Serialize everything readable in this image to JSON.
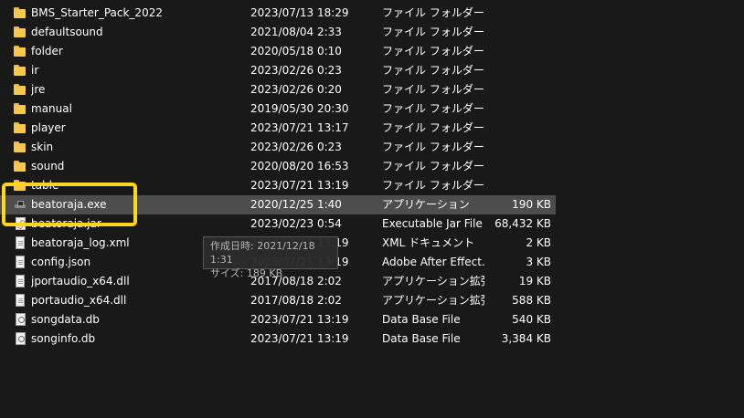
{
  "rows": [
    {
      "name": "BMS_Starter_Pack_2022",
      "date": "2023/07/13 18:29",
      "type": "ファイル フォルダー",
      "size": "",
      "icon": "folder-icon"
    },
    {
      "name": "defaultsound",
      "date": "2021/08/04 2:33",
      "type": "ファイル フォルダー",
      "size": "",
      "icon": "folder-icon"
    },
    {
      "name": "folder",
      "date": "2020/05/18 0:10",
      "type": "ファイル フォルダー",
      "size": "",
      "icon": "folder-icon"
    },
    {
      "name": "ir",
      "date": "2023/02/26 0:23",
      "type": "ファイル フォルダー",
      "size": "",
      "icon": "folder-icon"
    },
    {
      "name": "jre",
      "date": "2023/02/26 0:20",
      "type": "ファイル フォルダー",
      "size": "",
      "icon": "folder-icon"
    },
    {
      "name": "manual",
      "date": "2019/05/30 20:30",
      "type": "ファイル フォルダー",
      "size": "",
      "icon": "folder-icon"
    },
    {
      "name": "player",
      "date": "2023/07/21 13:17",
      "type": "ファイル フォルダー",
      "size": "",
      "icon": "folder-icon"
    },
    {
      "name": "skin",
      "date": "2023/02/26 0:23",
      "type": "ファイル フォルダー",
      "size": "",
      "icon": "folder-icon"
    },
    {
      "name": "sound",
      "date": "2020/08/20 16:53",
      "type": "ファイル フォルダー",
      "size": "",
      "icon": "folder-icon"
    },
    {
      "name": "table",
      "date": "2023/07/21 13:19",
      "type": "ファイル フォルダー",
      "size": "",
      "icon": "folder-icon"
    },
    {
      "name": "beatoraja.exe",
      "date": "2020/12/25 1:40",
      "type": "アプリケーション",
      "size": "190 KB",
      "icon": "exe-icon"
    },
    {
      "name": "beatoraja.jar",
      "date": "2023/02/23 0:54",
      "type": "Executable Jar File",
      "size": "68,432 KB",
      "icon": "jar-icon"
    },
    {
      "name": "beatoraja_log.xml",
      "date": "2023/07/21 13:19",
      "type": "XML ドキュメント",
      "size": "2 KB",
      "icon": "file-icon"
    },
    {
      "name": "config.json",
      "date": "2023/07/21 13:19",
      "type": "Adobe After Effect...",
      "size": "3 KB",
      "icon": "file-icon"
    },
    {
      "name": "jportaudio_x64.dll",
      "date": "2017/08/18 2:02",
      "type": "アプリケーション拡張",
      "size": "19 KB",
      "icon": "file-icon"
    },
    {
      "name": "portaudio_x64.dll",
      "date": "2017/08/18 2:02",
      "type": "アプリケーション拡張",
      "size": "588 KB",
      "icon": "file-icon"
    },
    {
      "name": "songdata.db",
      "date": "2023/07/21 13:19",
      "type": "Data Base File",
      "size": "540 KB",
      "icon": "db-icon"
    },
    {
      "name": "songinfo.db",
      "date": "2023/07/21 13:19",
      "type": "Data Base File",
      "size": "3,384 KB",
      "icon": "db-icon"
    }
  ],
  "selected_index": 10,
  "tooltip": {
    "line1": "作成日時: 2021/12/18 1:31",
    "line2": "サイズ: 189 KB"
  },
  "colors": {
    "background": "#191919",
    "selection": "#4d4d4d",
    "highlight_box": "#ffd51f",
    "folder": "#f6c94d"
  }
}
